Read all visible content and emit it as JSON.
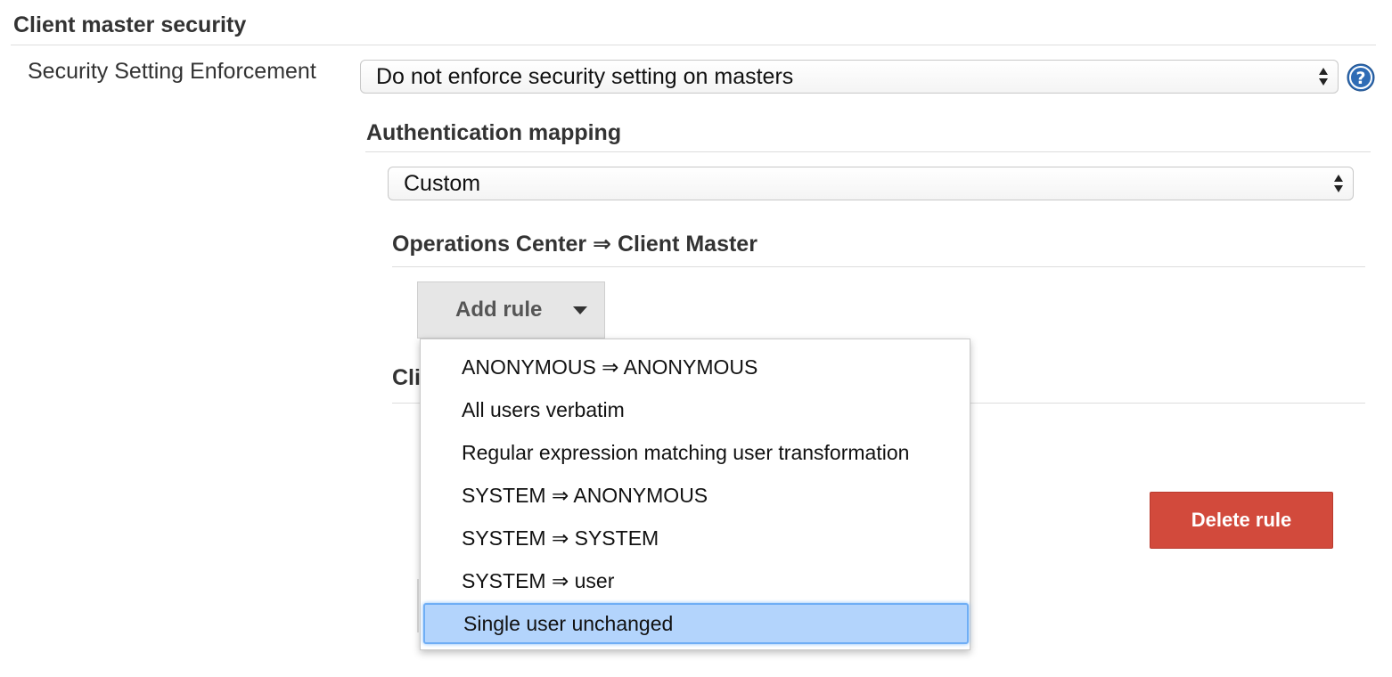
{
  "section": {
    "title": "Client master security"
  },
  "enforcement": {
    "label": "Security Setting Enforcement",
    "selected_value": "Do not enforce security setting on masters",
    "help_icon": "question-circle-icon"
  },
  "auth_mapping": {
    "title": "Authentication mapping",
    "selected_value": "Custom"
  },
  "oc_to_client": {
    "title": "Operations Center ⇒ Client Master",
    "add_rule_label": "Add rule",
    "menu_items": [
      "ANONYMOUS ⇒ ANONYMOUS",
      "All users verbatim",
      "Regular expression matching user transformation",
      "SYSTEM ⇒ ANONYMOUS",
      "SYSTEM ⇒ SYSTEM",
      "SYSTEM ⇒ user",
      "Single user unchanged"
    ],
    "highlighted_index": 6
  },
  "client_to_oc": {
    "title_clipped": "Cli"
  },
  "delete_rule_label": "Delete rule",
  "colors": {
    "delete_button": "#d24a3c",
    "menu_highlight": "#b3d4fc",
    "help_icon": "#2f6cb5"
  }
}
